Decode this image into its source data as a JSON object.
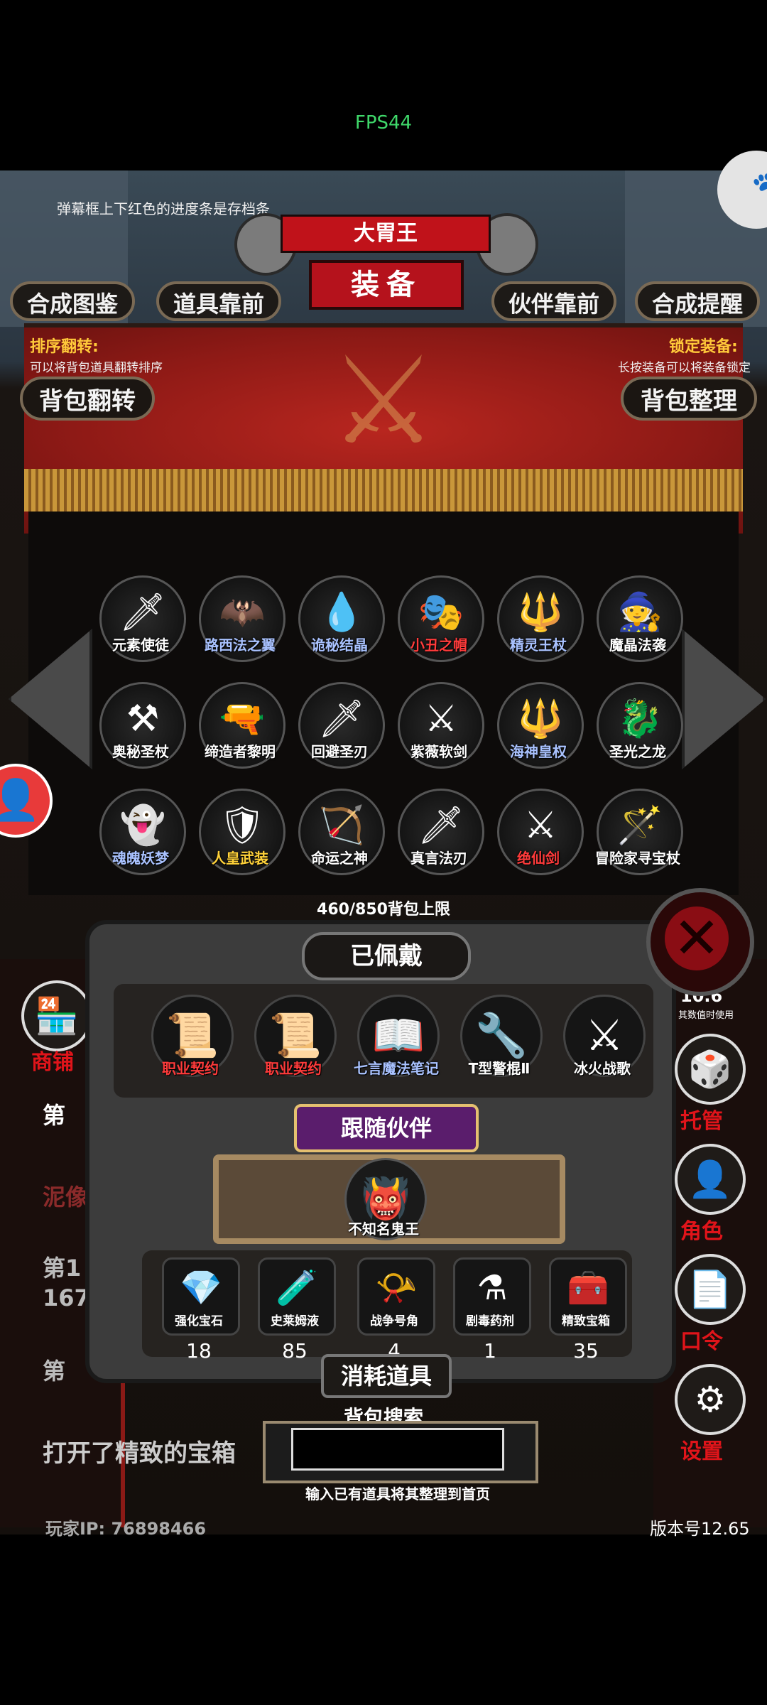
{
  "fps": "FPS44",
  "hint": "弹幕框上下红色的进度条是存档条",
  "title_top": "大胃王",
  "title_main": "装备",
  "tabs": [
    "合成图鉴",
    "道具靠前",
    "伙伴靠前",
    "合成提醒"
  ],
  "sort_flip": {
    "label": "排序翻转:",
    "desc": "可以将背包道具翻转排序",
    "button": "背包翻转"
  },
  "lock_equip": {
    "label": "锁定装备:",
    "desc": "长按装备可以将装备锁定",
    "button": "背包整理"
  },
  "bag_items": [
    {
      "name": "元素使徒",
      "color": "#ffffff",
      "icon": "🗡"
    },
    {
      "name": "路西法之翼",
      "color": "#a9c2ff",
      "icon": "🦇"
    },
    {
      "name": "诡秘结晶",
      "color": "#a9c2ff",
      "icon": "💧"
    },
    {
      "name": "小丑之帽",
      "color": "#ff3b3b",
      "icon": "🎭"
    },
    {
      "name": "精灵王杖",
      "color": "#a9c2ff",
      "icon": "🔱"
    },
    {
      "name": "魔晶法袭",
      "color": "#ffffff",
      "icon": "🧙"
    },
    {
      "name": "奥秘圣杖",
      "color": "#ffffff",
      "icon": "⚒"
    },
    {
      "name": "缔造者黎明",
      "color": "#ffffff",
      "icon": "🔫"
    },
    {
      "name": "回避圣刃",
      "color": "#ffffff",
      "icon": "🗡"
    },
    {
      "name": "紫薇软剑",
      "color": "#ffffff",
      "icon": "⚔"
    },
    {
      "name": "海神皇权",
      "color": "#a9c2ff",
      "icon": "🔱"
    },
    {
      "name": "圣光之龙",
      "color": "#ffffff",
      "icon": "🐉"
    },
    {
      "name": "魂魄妖梦",
      "color": "#a9c2ff",
      "icon": "👻"
    },
    {
      "name": "人皇武装",
      "color": "#ffd23a",
      "icon": "🛡"
    },
    {
      "name": "命运之神",
      "color": "#ffffff",
      "icon": "🏹"
    },
    {
      "name": "真言法刃",
      "color": "#ffffff",
      "icon": "🗡"
    },
    {
      "name": "绝仙剑",
      "color": "#ff3b3b",
      "icon": "⚔"
    },
    {
      "name": "冒险家寻宝杖",
      "color": "#ffffff",
      "icon": "🪄"
    }
  ],
  "capacity": "460/850背包上限",
  "equipped_title": "已佩戴",
  "equipped": [
    {
      "name": "职业契约",
      "color": "#ff3b3b",
      "icon": "📜"
    },
    {
      "name": "职业契约",
      "color": "#ff3b3b",
      "icon": "📜"
    },
    {
      "name": "七言魔法笔记",
      "color": "#a9c2ff",
      "icon": "📖"
    },
    {
      "name": "T型警棍Ⅱ",
      "color": "#ffffff",
      "icon": "🔧"
    },
    {
      "name": "冰火战歌",
      "color": "#ffffff",
      "icon": "⚔"
    }
  ],
  "companion_title": "跟随伙伴",
  "companion": {
    "name": "不知名鬼王",
    "icon": "👹"
  },
  "consumables": [
    {
      "name": "强化宝石",
      "count": "18",
      "icon": "💎"
    },
    {
      "name": "史莱姆液",
      "count": "85",
      "icon": "🧪"
    },
    {
      "name": "战争号角",
      "count": "4",
      "icon": "📯"
    },
    {
      "name": "剧毒药剂",
      "count": "1",
      "icon": "⚗"
    },
    {
      "name": "精致宝箱",
      "count": "35",
      "icon": "🧰"
    }
  ],
  "consumables_title": "消耗道具",
  "search": {
    "title": "背包搜索",
    "placeholder": "",
    "hint": "输入已有道具将其整理到首页"
  },
  "left_panel": {
    "shop": "商铺",
    "texts": [
      "第",
      "泥像",
      "第1",
      "167",
      "第"
    ]
  },
  "log": "打开了精致的宝箱",
  "player_ip": "玩家IP:  76898466",
  "version": "版本号12.65",
  "side_buttons": [
    {
      "label": "托管",
      "icon": "🎲"
    },
    {
      "label": "角色",
      "icon": "👤"
    },
    {
      "label": "口令",
      "icon": "📄"
    },
    {
      "label": "设置",
      "icon": "⚙"
    }
  ],
  "count_top": "10.6",
  "count_sub": "其数值时使用",
  "colors": {
    "accent_red": "#b5121c",
    "gold": "#ffc93a",
    "blue_label": "#a9c2ff"
  }
}
